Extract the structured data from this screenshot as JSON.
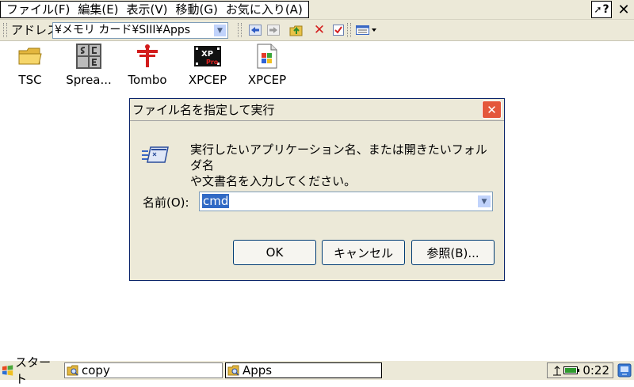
{
  "menubar": {
    "items": [
      "ファイル(F)",
      "編集(E)",
      "表示(V)",
      "移動(G)",
      "お気に入り(A)"
    ],
    "help_label": "?"
  },
  "toolbar": {
    "address_label": "アドレス",
    "address_value": "¥メモリ カード¥SIII¥Apps"
  },
  "desktop": {
    "icons": [
      {
        "label": "TSC",
        "icon": "folder-icon"
      },
      {
        "label": "Sprea...",
        "icon": "spreadsheet-app-icon"
      },
      {
        "label": "Tombo",
        "icon": "tombo-app-icon"
      },
      {
        "label": "XPCEP",
        "icon": "xpcep-pro-icon"
      },
      {
        "label": "XPCEP",
        "icon": "xpcep-document-icon"
      }
    ]
  },
  "dialog": {
    "title": "ファイル名を指定して実行",
    "message_line1": "実行したいアプリケーション名、または開きたいフォルダ名",
    "message_line2": "や文書名を入力してください。",
    "name_label": "名前(O):",
    "input_value": "cmd",
    "ok_label": "OK",
    "cancel_label": "キャンセル",
    "browse_label": "参照(B)..."
  },
  "taskbar": {
    "start_label": "スタート",
    "tasks": [
      {
        "label": "copy"
      },
      {
        "label": "Apps"
      }
    ],
    "clock": "0:22"
  },
  "colors": {
    "chrome": "#ece9d8",
    "selection": "#316ac5",
    "close_red": "#e4573b"
  }
}
